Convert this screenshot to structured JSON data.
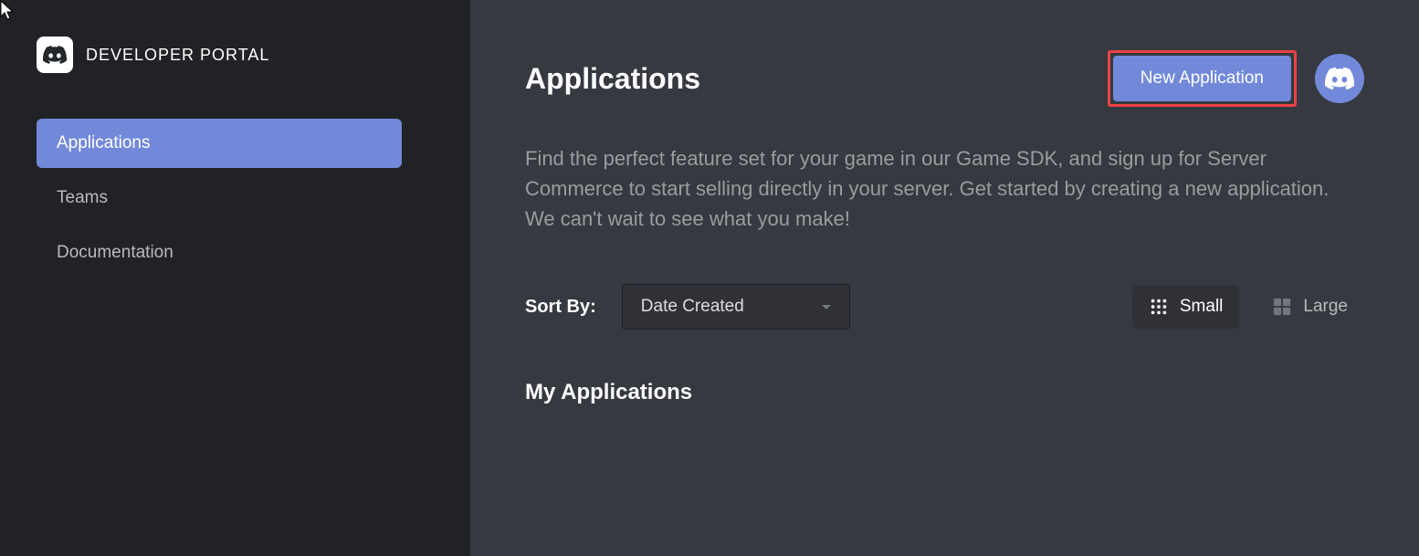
{
  "sidebar": {
    "title": "DEVELOPER PORTAL",
    "nav": [
      {
        "label": "Applications",
        "active": true
      },
      {
        "label": "Teams",
        "active": false
      },
      {
        "label": "Documentation",
        "active": false
      }
    ]
  },
  "header": {
    "title": "Applications",
    "new_button": "New Application"
  },
  "description": "Find the perfect feature set for your game in our Game SDK, and sign up for Server Commerce to start selling directly in your server. Get started by creating a new application. We can't wait to see what you make!",
  "sort": {
    "label": "Sort By:",
    "selected": "Date Created"
  },
  "view": {
    "small": "Small",
    "large": "Large"
  },
  "section": {
    "my_applications": "My Applications"
  }
}
